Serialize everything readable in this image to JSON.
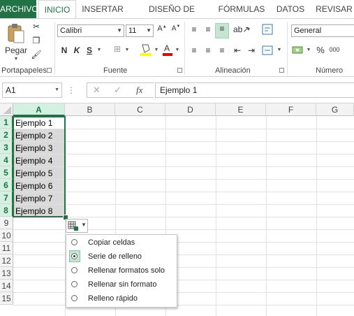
{
  "tabs": [
    "ARCHIVO",
    "INICIO",
    "INSERTAR",
    "DISEÑO DE PÁGINA",
    "FÓRMULAS",
    "DATOS",
    "REVISAR"
  ],
  "ribbon": {
    "clipboard": {
      "paste_label": "Pegar",
      "group_label": "Portapapeles"
    },
    "font": {
      "font_name": "Calibri",
      "font_size": "11",
      "group_label": "Fuente",
      "bold": "N",
      "italic": "K",
      "underline": "S"
    },
    "alignment": {
      "group_label": "Alineación"
    },
    "number": {
      "format": "General",
      "group_label": "Número",
      "percent": "%",
      "thousands": "000"
    }
  },
  "formula_bar": {
    "name_box": "A1",
    "fx": "fx",
    "content": "Ejemplo 1"
  },
  "columns": [
    "A",
    "B",
    "C",
    "D",
    "E",
    "F",
    "G"
  ],
  "rows": [
    "1",
    "2",
    "3",
    "4",
    "5",
    "6",
    "7",
    "8",
    "9",
    "10",
    "11",
    "12",
    "13",
    "14",
    "15"
  ],
  "cells_A": [
    "Ejemplo 1",
    "Ejemplo 2",
    "Ejemplo 3",
    "Ejemplo 4",
    "Ejemplo 5",
    "Ejemplo 6",
    "Ejemplo 7",
    "Ejemplo 8"
  ],
  "autofill_menu": [
    {
      "label": "Copiar celdas",
      "selected": false
    },
    {
      "label": "Serie de relleno",
      "selected": true
    },
    {
      "label": "Rellenar formatos solo",
      "selected": false
    },
    {
      "label": "Rellenar sin formato",
      "selected": false
    },
    {
      "label": "Relleno rápido",
      "selected": false
    }
  ],
  "colors": {
    "accent": "#217346",
    "selection_fill": "#d9d9d9",
    "header_selected": "#d3f0e0"
  }
}
